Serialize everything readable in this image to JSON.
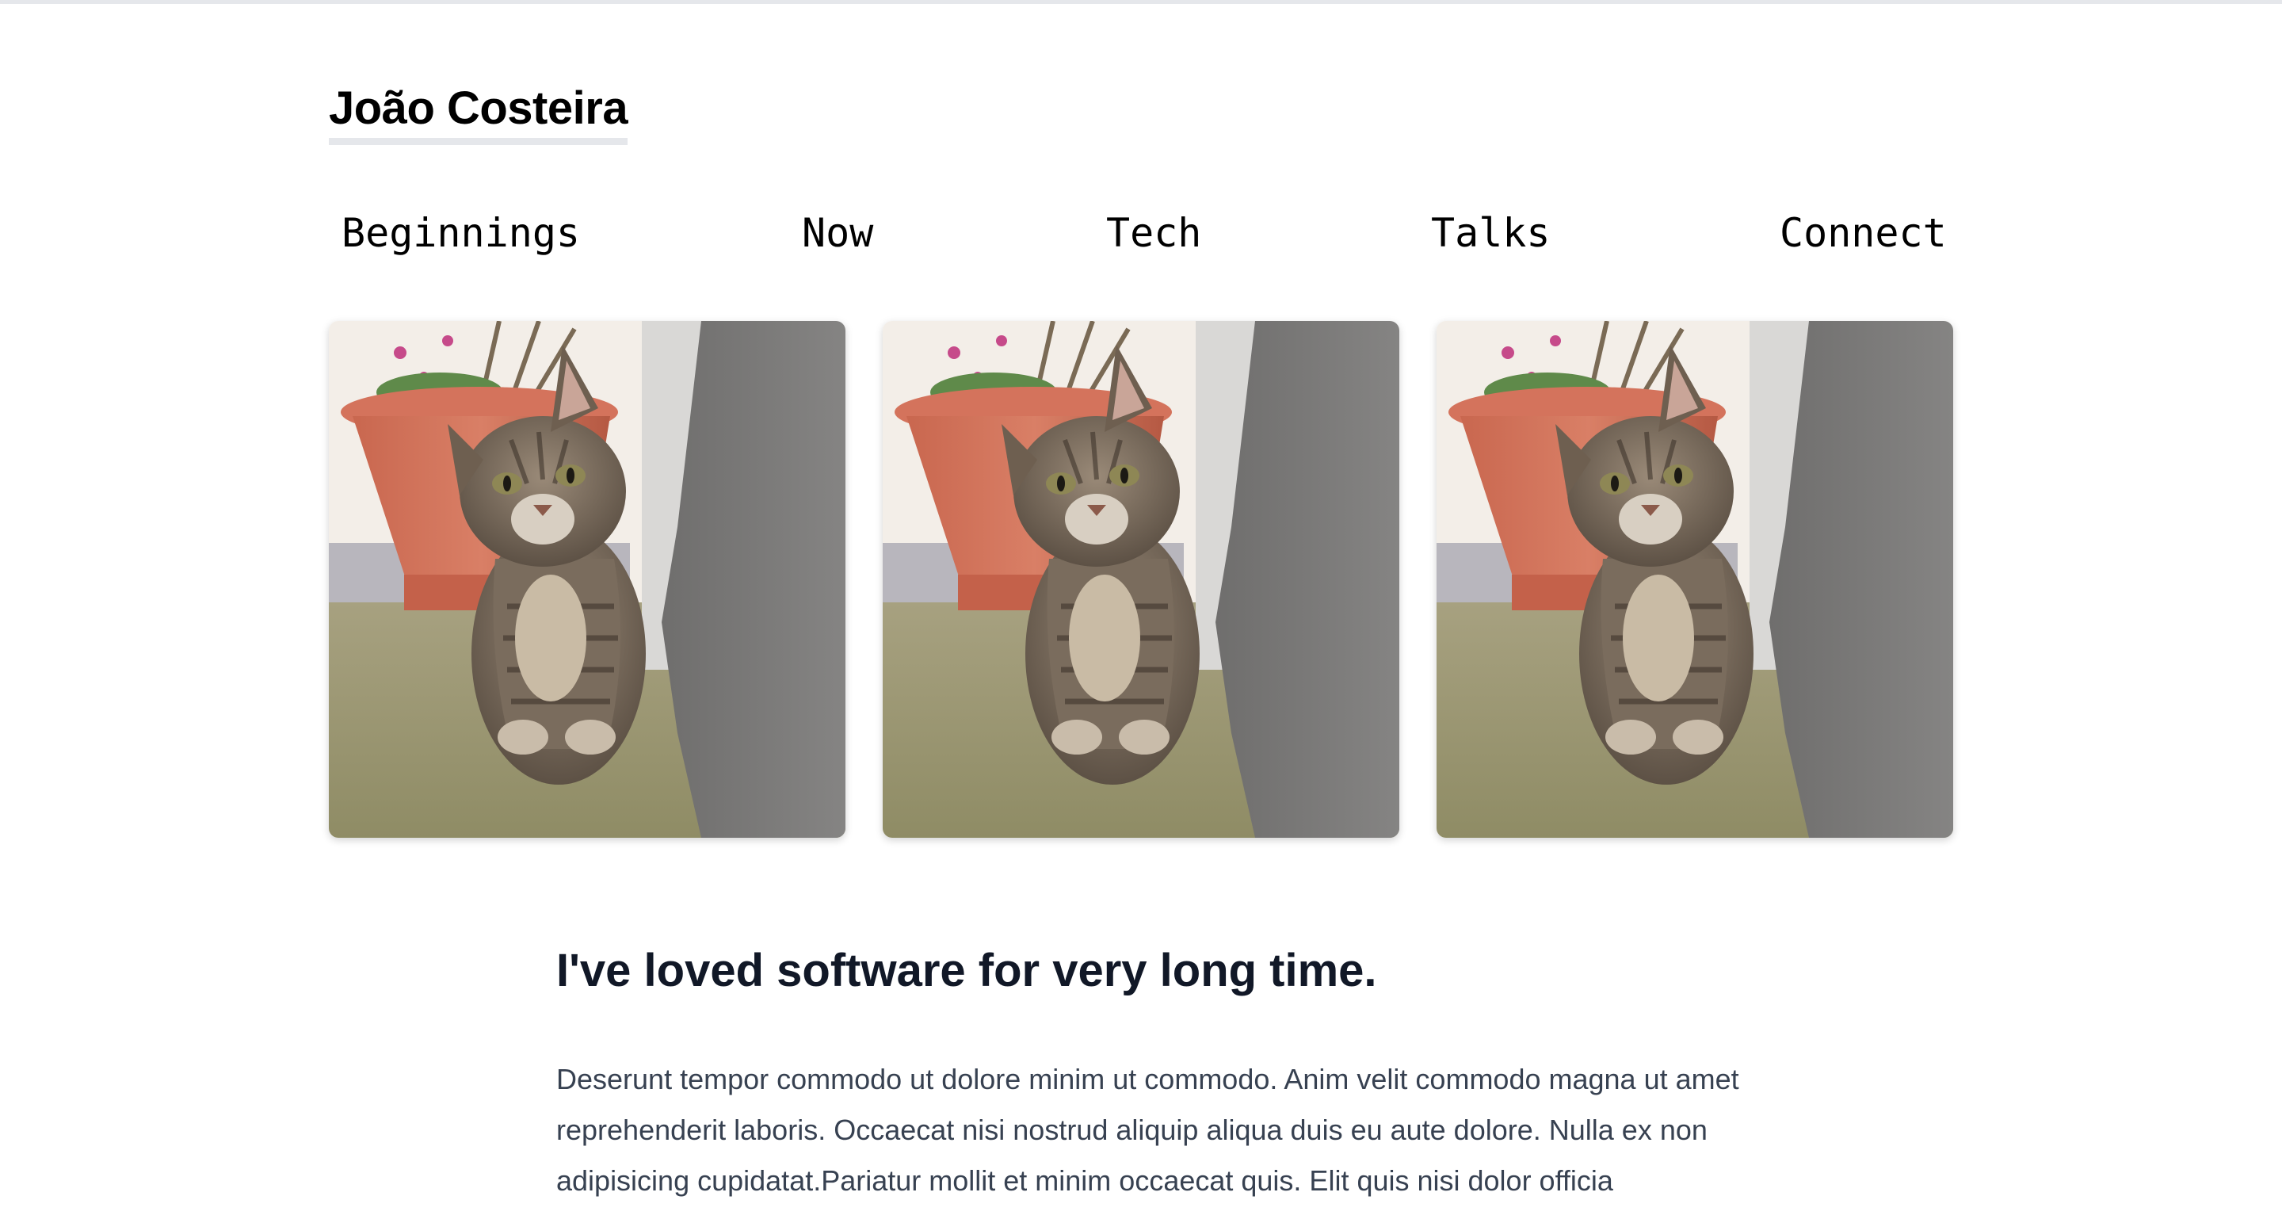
{
  "site": {
    "title": "João Costeira"
  },
  "nav": {
    "items": [
      {
        "label": "Beginnings"
      },
      {
        "label": "Now"
      },
      {
        "label": "Tech"
      },
      {
        "label": "Talks"
      },
      {
        "label": "Connect"
      }
    ]
  },
  "gallery": {
    "images": [
      {
        "subject": "kitten-next-to-flower-pot"
      },
      {
        "subject": "kitten-next-to-flower-pot"
      },
      {
        "subject": "kitten-next-to-flower-pot"
      }
    ]
  },
  "article": {
    "headline": "I've loved software for very long time.",
    "paragraph": "Deserunt tempor commodo ut dolore minim ut commodo. Anim velit commodo magna ut amet reprehenderit laboris. Occaecat nisi nostrud aliquip aliqua duis eu aute dolore. Nulla ex non adipisicing cupidatat.Pariatur mollit et minim occaecat quis. Elit quis nisi dolor officia"
  },
  "colors": {
    "heading": "#111827",
    "body": "#374151",
    "title_underline": "#e5e7eb",
    "pot": "#c96a52",
    "floor": "#9c9874",
    "wall": "#7d7c7b"
  }
}
